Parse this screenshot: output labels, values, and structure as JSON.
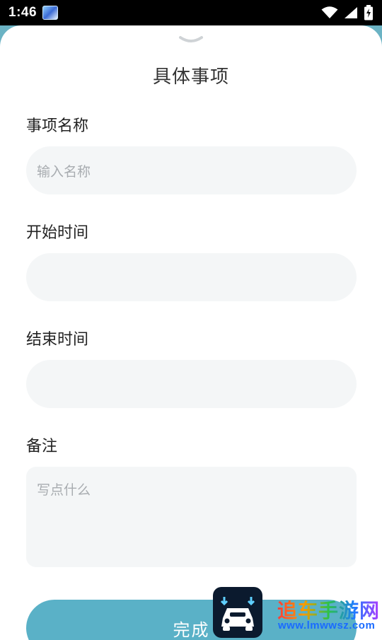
{
  "status_bar": {
    "time": "1:46",
    "icons": [
      "app-notification-icon",
      "wifi-icon",
      "cellular-signal-icon",
      "battery-charging-icon"
    ]
  },
  "sheet": {
    "handle_icon": "chevron-down-icon",
    "title": "具体事项",
    "fields": [
      {
        "label": "事项名称",
        "placeholder": "输入名称",
        "value": ""
      },
      {
        "label": "开始时间",
        "placeholder": "",
        "value": ""
      },
      {
        "label": "结束时间",
        "placeholder": "",
        "value": ""
      },
      {
        "label": "备注",
        "placeholder": "写点什么",
        "value": ""
      }
    ],
    "submit_label": "完成"
  },
  "watermark": {
    "title": "追车手游网",
    "url": "www.lmwwsz.com"
  },
  "colors": {
    "accent": "#5ab1c7",
    "input_bg": "#f4f6f7",
    "placeholder": "#a8acb0",
    "backdrop": "#6bb3c4"
  }
}
